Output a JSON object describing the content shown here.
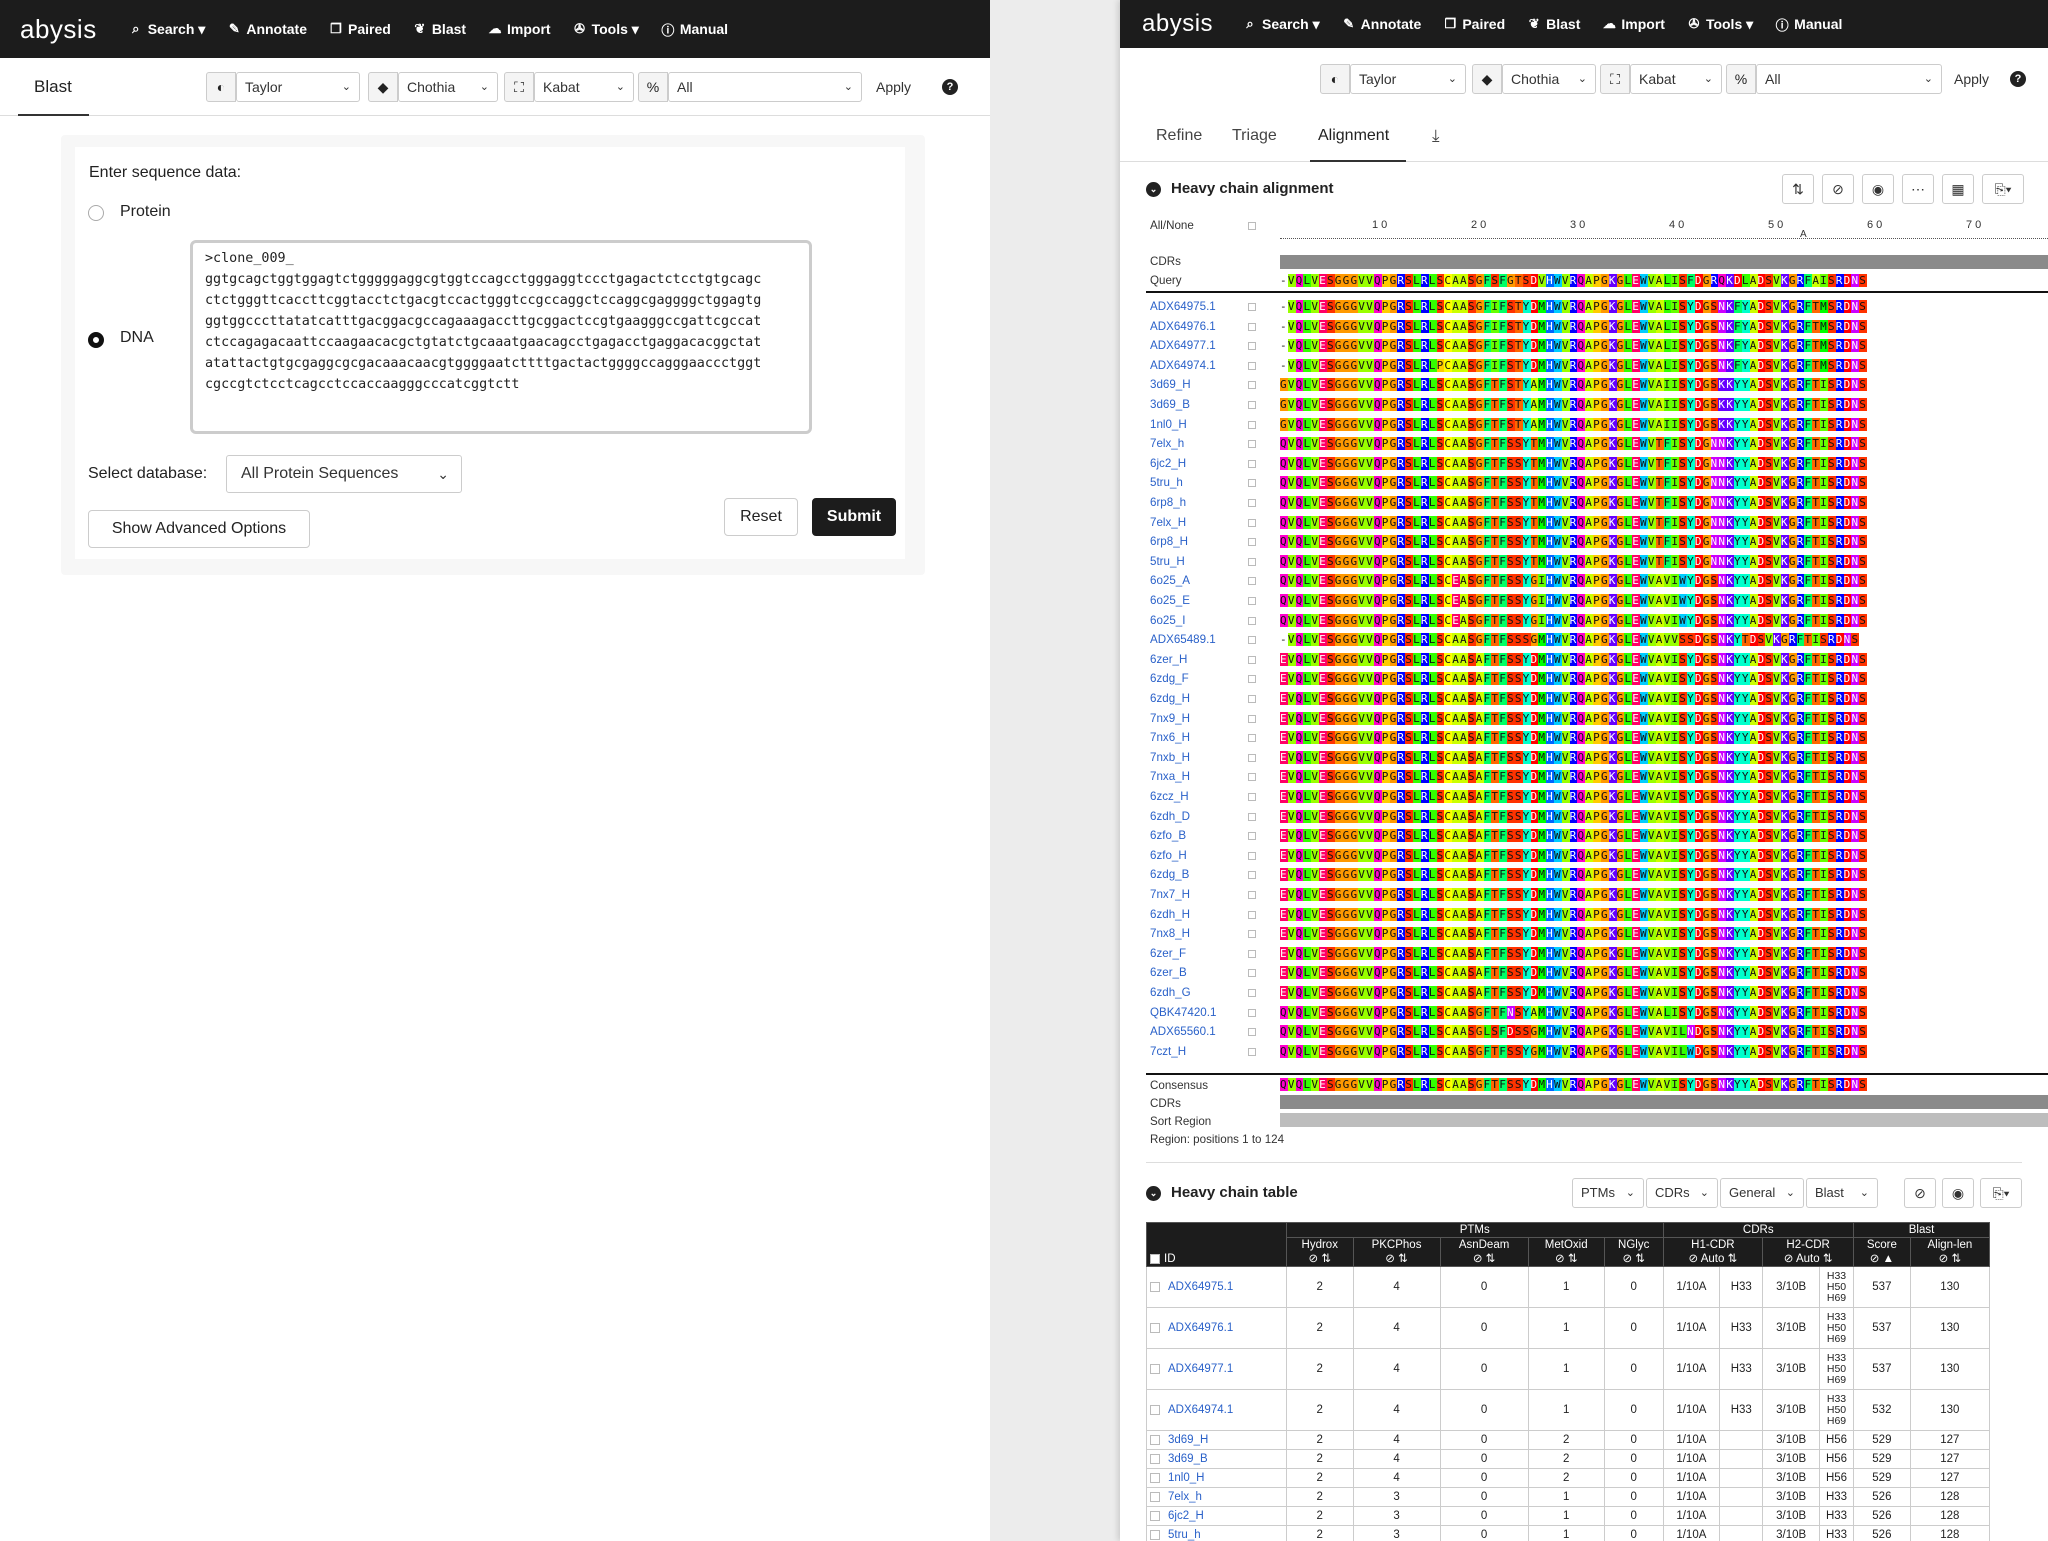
{
  "left": {
    "nav": {
      "logo": "abysis",
      "items": [
        "Search ▾",
        "Annotate",
        "Paired",
        "Blast",
        "Import",
        "Tools ▾",
        "Manual"
      ]
    },
    "tab": "Blast",
    "selects": {
      "color": "Taylor",
      "numbering": "Chothia",
      "region": "Kabat",
      "filter": "All"
    },
    "apply": "Apply",
    "help": "?",
    "enter_label": "Enter sequence data:",
    "protein_label": "Protein",
    "dna_label": "DNA",
    "sequence": ">clone_009_\nggtgcagctggtggagtctgggggaggcgtggtccagcctgggaggtccctgagactctcctgtgcagc\nctctgggttcaccttcggtacctctgacgtccactgggtccgccaggctccaggcgaggggctggagtg\nggtggcccttatatcatttgacggacgccagaaagaccttgcggactccgtgaagggccgattcgccat\nctccagagacaattccaagaacacgctgtatctgcaaatgaacagcctgagacctgaggacacggctat\natattactgtgcgaggcgcgacaaacaacgtggggaatcttttgactactggggccagggaaccctggt\ncgccgtctcctcagcctccaccaagggcccatcggtctt",
    "select_db_label": "Select database:",
    "database": "All Protein Sequences",
    "advanced": "Show Advanced Options",
    "reset": "Reset",
    "submit": "Submit"
  },
  "right": {
    "nav": {
      "logo": "abysis",
      "items": [
        "Search ▾",
        "Annotate",
        "Paired",
        "Blast",
        "Import",
        "Tools ▾",
        "Manual"
      ]
    },
    "selects": {
      "color": "Taylor",
      "numbering": "Chothia",
      "region": "Kabat",
      "filter": "All"
    },
    "apply": "Apply",
    "help": "?",
    "tabs": [
      "Refine",
      "Triage",
      "Alignment"
    ],
    "active_tab": "Alignment",
    "alignment": {
      "title": "Heavy chain alignment",
      "all_none": "All/None",
      "ruler": [
        "1 0",
        "2 0",
        "3 0",
        "4 0",
        "5 0",
        "6 0",
        "7 0"
      ],
      "ruler_mark": "A",
      "cdrs_label": "CDRs",
      "query_label": "Query",
      "query_seq": "-VQLVESGGGVVQPGRSLRLSCAASGFSFGTSDVHWVRQAPGKGLEWVALISFDGRQKDLADSVKGRFAISRDNS",
      "rows": [
        {
          "id": "ADX64975.1",
          "seq": "-VQLVESGGGVVQPGRSLRLSCAASGFIFSTYDMHWVRQAPGKGLEWVALISYDGSNKFYADSVKGRFTMSRDNS"
        },
        {
          "id": "ADX64976.1",
          "seq": "-VQLVESGGGVVQPGRSLRLSCAASGFIFSTYDMHWVRQAPGKGLEWVALISYDGSNKFYADSVKGRFTMSRDNS"
        },
        {
          "id": "ADX64977.1",
          "seq": "-VQLVESGGGVVQPGRSLRLSCAASGFIFSTYDMHWVRQAPGKGLEWVALISYDGSNKFYADSVKGRFTMSRDNS"
        },
        {
          "id": "ADX64974.1",
          "seq": "-VQLVESGGGVVQPGRSLRLPCAASGFIFSTYDMHWVRQAPGKGLEWVALISYDGSNKFYADSVKGRFTMSRDNS"
        },
        {
          "id": "3d69_H",
          "seq": "GVQLVESGGGVVQPGRSLRLSCAASGFTFSTYAMHWVRQAPGKGLEWVAIISYDGSKKYYADSVKGRFTISRDNS"
        },
        {
          "id": "3d69_B",
          "seq": "GVQLVESGGGVVQPGRSLRLSCAASGFTFSTYAMHWVRQAPGKGLEWVAIISYDGSKKYYADSVKGRFTISRDNS"
        },
        {
          "id": "1nl0_H",
          "seq": "GVQLVESGGGVVQPGRSLRLSCAASGFTFSTYAMHWVRQAPGKGLEWVAIISYDGSKKYYADSVKGRFTISRDNS"
        },
        {
          "id": "7elx_h",
          "seq": "QVQLVESGGGVVQPGRSLRLSCAASGFTFSSYTMHWVRQAPGKGLEWVTFISYDGNNKYYADSVKGRFTISRDNS"
        },
        {
          "id": "6jc2_H",
          "seq": "QVQLVESGGGVVQPGRSLRLSCAASGFTFSSYTMHWVRQAPGKGLEWVTFISYDGNNKYYADSVKGRFTISRDNS"
        },
        {
          "id": "5tru_h",
          "seq": "QVQLVESGGGVVQPGRSLRLSCAASGFTFSSYTMHWVRQAPGKGLEWVTFISYDGNNKYYADSVKGRFTISRDNS"
        },
        {
          "id": "6rp8_h",
          "seq": "QVQLVESGGGVVQPGRSLRLSCAASGFTFSSYTMHWVRQAPGKGLEWVTFISYDGNNKYYADSVKGRFTISRDNS"
        },
        {
          "id": "7elx_H",
          "seq": "QVQLVESGGGVVQPGRSLRLSCAASGFTFSSYTMHWVRQAPGKGLEWVTFISYDGNNKYYADSVKGRFTISRDNS"
        },
        {
          "id": "6rp8_H",
          "seq": "QVQLVESGGGVVQPGRSLRLSCAASGFTFSSYTMHWVRQAPGKGLEWVTFISYDGNNKYYADSVKGRFTISRDNS"
        },
        {
          "id": "5tru_H",
          "seq": "QVQLVESGGGVVQPGRSLRLSCAASGFTFSSYTMHWVRQAPGKGLEWVTFISYDGNNKYYADSVKGRFTISRDNS"
        },
        {
          "id": "6o25_A",
          "seq": "QVQLVESGGGVVQPGRSLRLSCEASGFTFSSYGIHWVRQAPGKGLEWVAVIWYDGSNKYYADSVKGRFTISRDNS"
        },
        {
          "id": "6o25_E",
          "seq": "QVQLVESGGGVVQPGRSLRLSCEASGFTFSSYGIHWVRQAPGKGLEWVAVIWYDGSNKYYADSVKGRFTISRDNS"
        },
        {
          "id": "6o25_I",
          "seq": "QVQLVESGGGVVQPGRSLRLSCEASGFTFSSYGIHWVRQAPGKGLEWVAVIWYDGSNKYYADSVKGRFTISRDNS"
        },
        {
          "id": "ADX65489.1",
          "seq": "-VQLVESGGGVVQPGRSLRLSCAASGFTFSSSGMHWVRQAPGKGLEWVAVVSSDGSNKYTDSVKGRFTISRDNS"
        },
        {
          "id": "6zer_H",
          "seq": "EVQLVESGGGVVQPGRSLRLSCAASAFTFSSYDMHWVRQAPGKGLEWVAVISYDGSNKYYADSVKGRFTISRDNS"
        },
        {
          "id": "6zdg_F",
          "seq": "EVQLVESGGGVVQPGRSLRLSCAASAFTFSSYDMHWVRQAPGKGLEWVAVISYDGSNKYYADSVKGRFTISRDNS"
        },
        {
          "id": "6zdg_H",
          "seq": "EVQLVESGGGVVQPGRSLRLSCAASAFTFSSYDMHWVRQAPGKGLEWVAVISYDGSNKYYADSVKGRFTISRDNS"
        },
        {
          "id": "7nx9_H",
          "seq": "EVQLVESGGGVVQPGRSLRLSCAASAFTFSSYDMHWVRQAPGKGLEWVAVISYDGSNKYYADSVKGRFTISRDNS"
        },
        {
          "id": "7nx6_H",
          "seq": "EVQLVESGGGVVQPGRSLRLSCAASAFTFSSYDMHWVRQAPGKGLEWVAVISYDGSNKYYADSVKGRFTISRDNS"
        },
        {
          "id": "7nxb_H",
          "seq": "EVQLVESGGGVVQPGRSLRLSCAASAFTFSSYDMHWVRQAPGKGLEWVAVISYDGSNKYYADSVKGRFTISRDNS"
        },
        {
          "id": "7nxa_H",
          "seq": "EVQLVESGGGVVQPGRSLRLSCAASAFTFSSYDMHWVRQAPGKGLEWVAVISYDGSNKYYADSVKGRFTISRDNS"
        },
        {
          "id": "6zcz_H",
          "seq": "EVQLVESGGGVVQPGRSLRLSCAASAFTFSSYDMHWVRQAPGKGLEWVAVISYDGSNKYYADSVKGRFTISRDNS"
        },
        {
          "id": "6zdh_D",
          "seq": "EVQLVESGGGVVQPGRSLRLSCAASAFTFSSYDMHWVRQAPGKGLEWVAVISYDGSNKYYADSVKGRFTISRDNS"
        },
        {
          "id": "6zfo_B",
          "seq": "EVQLVESGGGVVQPGRSLRLSCAASAFTFSSYDMHWVRQAPGKGLEWVAVISYDGSNKYYADSVKGRFTISRDNS"
        },
        {
          "id": "6zfo_H",
          "seq": "EVQLVESGGGVVQPGRSLRLSCAASAFTFSSYDMHWVRQAPGKGLEWVAVISYDGSNKYYADSVKGRFTISRDNS"
        },
        {
          "id": "6zdg_B",
          "seq": "EVQLVESGGGVVQPGRSLRLSCAASAFTFSSYDMHWVRQAPGKGLEWVAVISYDGSNKYYADSVKGRFTISRDNS"
        },
        {
          "id": "7nx7_H",
          "seq": "EVQLVESGGGVVQPGRSLRLSCAASAFTFSSYDMHWVRQAPGKGLEWVAVISYDGSNKYYADSVKGRFTISRDNS"
        },
        {
          "id": "6zdh_H",
          "seq": "EVQLVESGGGVVQPGRSLRLSCAASAFTFSSYDMHWVRQAPGKGLEWVAVISYDGSNKYYADSVKGRFTISRDNS"
        },
        {
          "id": "7nx8_H",
          "seq": "EVQLVESGGGVVQPGRSLRLSCAASAFTFSSYDMHWVRQAPGKGLEWVAVISYDGSNKYYADSVKGRFTISRDNS"
        },
        {
          "id": "6zer_F",
          "seq": "EVQLVESGGGVVQPGRSLRLSCAASAFTFSSYDMHWVRQAPGKGLEWVAVISYDGSNKYYADSVKGRFTISRDNS"
        },
        {
          "id": "6zer_B",
          "seq": "EVQLVESGGGVVQPGRSLRLSCAASAFTFSSYDMHWVRQAPGKGLEWVAVISYDGSNKYYADSVKGRFTISRDNS"
        },
        {
          "id": "6zdh_G",
          "seq": "EVQLVESGGGVVQPGRSLRLSCAASAFTFSSYDMHWVRQAPGKGLEWVAVISYDGSNKYYADSVKGRFTISRDNS"
        },
        {
          "id": "QBK47420.1",
          "seq": "QVQLVESGGGVVQPGRSLRLSCAASGFTFNSYAMHWVRQAPGKGLEWVALISYDGSNKYYADSVKGRFTISRDNS"
        },
        {
          "id": "ADX65560.1",
          "seq": "QVQLVESGGGVVQPGRSLRLSCAASGLSFDSSGMHWVRQAPGKGLEWVAVILNDGSNKYYADSVKGRFTISRDNS"
        },
        {
          "id": "7czt_H",
          "seq": "QVQLVESGGGVVQPGRSLRLSCAASGFTFSSYGMHWVRQAPGKGLEWVAVILWDGSNKYYADSVKGRFTISRDNS"
        }
      ],
      "consensus_label": "Consensus",
      "consensus_seq": "QVQLVESGGGVVQPGRSLRLSCAASGFTFSSYDMHWVRQAPGKGLEWVAVISYDGSNKYYADSVKGRFTISRDNS",
      "sort_region_label": "Sort Region",
      "region_text": "Region: positions 1 to 124"
    },
    "table": {
      "title": "Heavy chain table",
      "filters": [
        "PTMs",
        "CDRs",
        "General",
        "Blast"
      ],
      "groups": {
        "ptms": "PTMs",
        "cdrs": "CDRs",
        "blast": "Blast"
      },
      "columns": [
        "Hydrox",
        "PKCPhos",
        "AsnDeam",
        "MetOxid",
        "NGlyc",
        "H1-CDR",
        "H2-CDR",
        "Score",
        "Align-len"
      ],
      "auto": "Auto",
      "id_col": "ID",
      "rows": [
        {
          "id": "ADX64975.1",
          "v": [
            "2",
            "4",
            "0",
            "1",
            "0",
            "1/10A",
            "H33",
            "3/10B",
            "H33 H50 H69",
            "537",
            "130"
          ]
        },
        {
          "id": "ADX64976.1",
          "v": [
            "2",
            "4",
            "0",
            "1",
            "0",
            "1/10A",
            "H33",
            "3/10B",
            "H33 H50 H69",
            "537",
            "130"
          ]
        },
        {
          "id": "ADX64977.1",
          "v": [
            "2",
            "4",
            "0",
            "1",
            "0",
            "1/10A",
            "H33",
            "3/10B",
            "H33 H50 H69",
            "537",
            "130"
          ]
        },
        {
          "id": "ADX64974.1",
          "v": [
            "2",
            "4",
            "0",
            "1",
            "0",
            "1/10A",
            "H33",
            "3/10B",
            "H33 H50 H69",
            "532",
            "130"
          ]
        },
        {
          "id": "3d69_H",
          "v": [
            "2",
            "4",
            "0",
            "2",
            "0",
            "1/10A",
            "",
            "3/10B",
            "H56",
            "529",
            "127"
          ]
        },
        {
          "id": "3d69_B",
          "v": [
            "2",
            "4",
            "0",
            "2",
            "0",
            "1/10A",
            "",
            "3/10B",
            "H56",
            "529",
            "127"
          ]
        },
        {
          "id": "1nl0_H",
          "v": [
            "2",
            "4",
            "0",
            "2",
            "0",
            "1/10A",
            "",
            "3/10B",
            "H56",
            "529",
            "127"
          ]
        },
        {
          "id": "7elx_h",
          "v": [
            "2",
            "3",
            "0",
            "1",
            "0",
            "1/10A",
            "",
            "3/10B",
            "H33",
            "526",
            "128"
          ]
        },
        {
          "id": "6jc2_H",
          "v": [
            "2",
            "3",
            "0",
            "1",
            "0",
            "1/10A",
            "",
            "3/10B",
            "H33",
            "526",
            "128"
          ]
        },
        {
          "id": "5tru_h",
          "v": [
            "2",
            "3",
            "0",
            "1",
            "0",
            "1/10A",
            "",
            "3/10B",
            "H33",
            "526",
            "128"
          ]
        }
      ]
    }
  },
  "colors": {
    "nav": "#1c1c1c",
    "link": "#2a61c9",
    "cdr_bar": "#8a8a8a",
    "region_bar": "#bdbdbd"
  }
}
